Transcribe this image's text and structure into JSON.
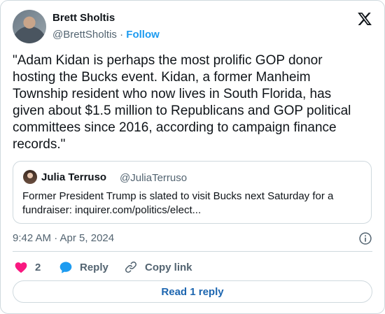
{
  "author": {
    "name": "Brett Sholtis",
    "handle": "@BrettSholtis",
    "separator": "·",
    "follow_label": "Follow"
  },
  "tweet": {
    "text": "\"Adam Kidan is perhaps the most prolific GOP donor\nhosting the Bucks event. Kidan, a former Manheim\nTownship resident who now lives in South Florida, has\ngiven about $1.5 million to Republicans and GOP political\ncommittees since 2016, according to campaign finance\nrecords.\"",
    "timestamp": "9:42 AM · Apr 5, 2024"
  },
  "quoted": {
    "name": "Julia Terruso",
    "handle": "@JuliaTerruso",
    "text": "Former President Trump is slated to visit Bucks next Saturday for a fundraiser: inquirer.com/politics/elect..."
  },
  "actions": {
    "like_count": "2",
    "reply_label": "Reply",
    "copy_label": "Copy link"
  },
  "read_reply_label": "Read 1 reply",
  "icons": {
    "platform_logo": "x-logo-icon",
    "info": "info-icon",
    "like": "heart-icon",
    "reply": "speech-bubble-icon",
    "copy": "link-icon"
  },
  "colors": {
    "accent": "#1d9bf0",
    "like": "#f91880",
    "muted_text": "#536471",
    "border": "#cfd9de"
  }
}
